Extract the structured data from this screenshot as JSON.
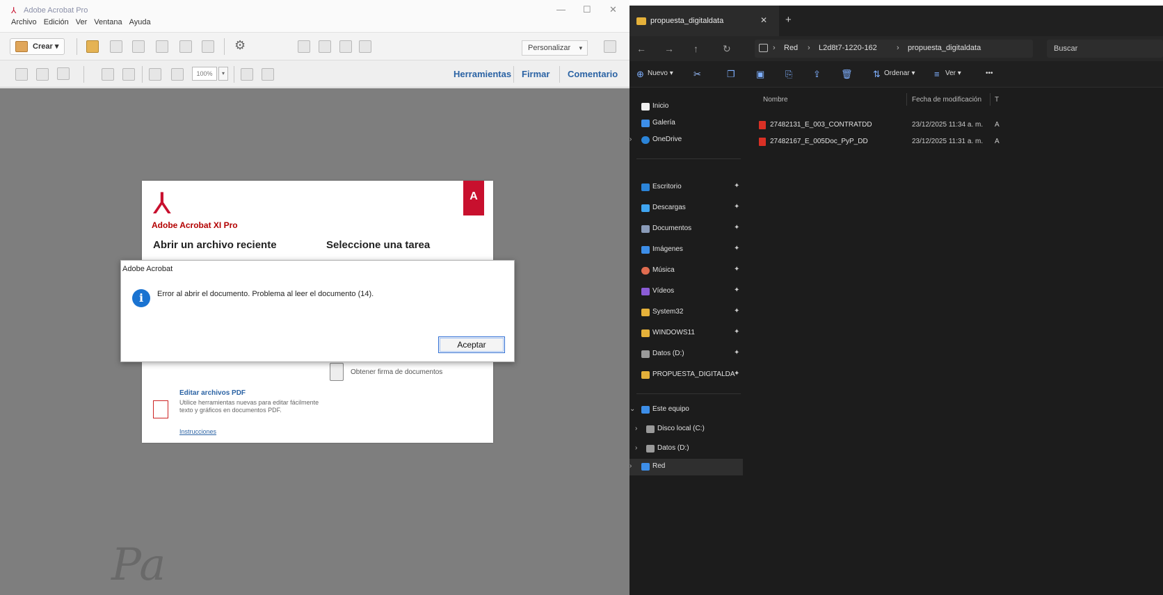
{
  "acrobat": {
    "window_title": "Adobe Acrobat Pro",
    "menu": [
      "Archivo",
      "Edición",
      "Ver",
      "Ventana",
      "Ayuda"
    ],
    "toolbar": {
      "create_label": "Crear",
      "create_caret": "▾",
      "customize_label": "Personalizar",
      "customize_caret": "▾",
      "zoom_value": "100%",
      "zoom_caret": "▾"
    },
    "pane_tabs": [
      "Herramientas",
      "Firmar",
      "Comentario"
    ],
    "welcome": {
      "brand_tag": "A",
      "product_name": "Adobe Acrobat XI Pro",
      "recent_heading": "Abrir un archivo reciente",
      "task_heading": "Seleccione una tarea",
      "task_forms_label": "Obtener firma de documentos",
      "edit_title": "Editar archivos PDF",
      "edit_desc": "Utilice herramientas nuevas para editar fácilmente texto y gráficos en documentos PDF.",
      "edit_link": "Instrucciones"
    },
    "dialog": {
      "title": "Adobe Acrobat",
      "info_glyph": "i",
      "message": "Error al abrir el documento. Problema al leer el documento (14).",
      "ok_label": "Aceptar"
    }
  },
  "explorer": {
    "tab_label": "propuesta_digitaldata",
    "tab_close": "✕",
    "tab_plus": "+",
    "breadcrumb": [
      "Red",
      "L2d8t7-1220-162",
      "propuesta_digitaldata"
    ],
    "search_placeholder": "Buscar",
    "commands": {
      "new_label": "Nuevo",
      "new_caret": "▾",
      "sort_label": "Ordenar",
      "sort_caret": "▾",
      "view_label": "Ver",
      "view_caret": "▾",
      "more_label": "•••"
    },
    "columns": {
      "name": "Nombre",
      "modified": "Fecha de modificación",
      "type": "T"
    },
    "files": [
      {
        "name": "27482131_E_003_CONTRATDD",
        "date": "23/12/2025 11:34 a. m.",
        "type": "A"
      },
      {
        "name": "27482167_E_005Doc_PyP_DD",
        "date": "23/12/2025 11:31 a. m.",
        "type": "A"
      }
    ],
    "nav": {
      "quick": [
        {
          "label": "Inicio",
          "color": "#f0f0f0"
        },
        {
          "label": "Galería",
          "color": "#3d8ee8"
        },
        {
          "label": "OneDrive",
          "color": "#2b84d8",
          "chevron": "›"
        }
      ],
      "pinned": [
        {
          "label": "Escritorio",
          "color": "#2b84d8"
        },
        {
          "label": "Descargas",
          "color": "#3fa4f0"
        },
        {
          "label": "Documentos",
          "color": "#8a9bb8"
        },
        {
          "label": "Imágenes",
          "color": "#3d8ee8"
        },
        {
          "label": "Música",
          "color": "#e06c50"
        },
        {
          "label": "Vídeos",
          "color": "#8b5cd6"
        },
        {
          "label": "System32",
          "color": "#e5b13a"
        },
        {
          "label": "WINDOWS11",
          "color": "#e5b13a"
        },
        {
          "label": "Datos (D:)",
          "color": "#9a9a9a"
        },
        {
          "label": "PROPUESTA_DIGITALDA",
          "color": "#e5b13a"
        }
      ],
      "pin_glyph": "✦",
      "devices": [
        {
          "label": "Este equipo",
          "color": "#3d8ee8",
          "chevron": "⌄"
        },
        {
          "label": "Disco local (C:)",
          "color": "#9a9a9a",
          "chevron": "›"
        },
        {
          "label": "Datos (D:)",
          "color": "#9a9a9a",
          "chevron": "›"
        },
        {
          "label": "Red",
          "color": "#3d8ee8",
          "chevron": "›",
          "selected": true
        }
      ]
    }
  }
}
